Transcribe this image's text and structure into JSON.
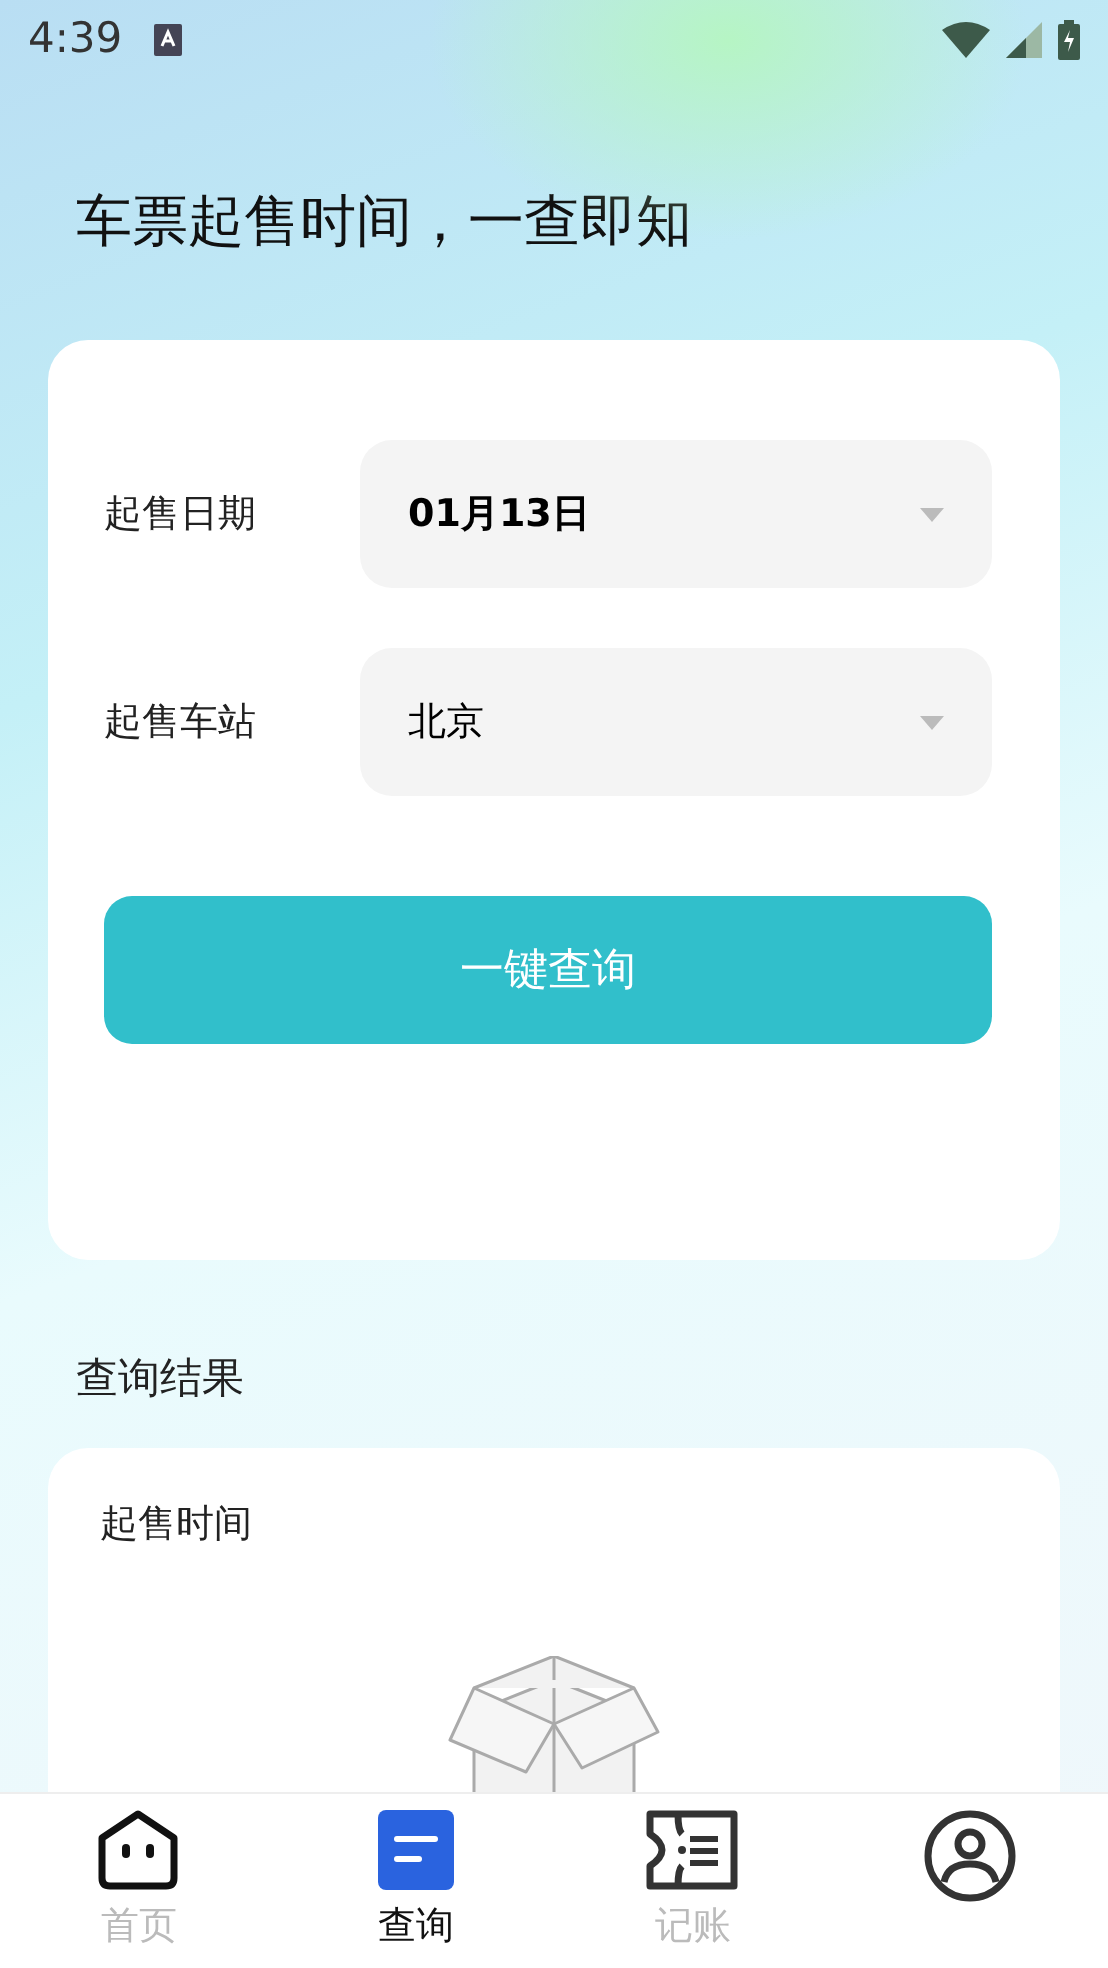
{
  "status_bar": {
    "time": "4:39"
  },
  "heading": "车票起售时间，一查即知",
  "form": {
    "fields": [
      {
        "label": "起售日期",
        "value": "01月13日",
        "bold": true
      },
      {
        "label": "起售车站",
        "value": "北京",
        "bold": false
      }
    ],
    "button": "一键查询"
  },
  "results": {
    "title": "查询结果",
    "card_title": "起售时间"
  },
  "tabs": [
    {
      "label": "首页",
      "kind": "home",
      "selected": false
    },
    {
      "label": "查询",
      "kind": "query",
      "selected": true
    },
    {
      "label": "记账",
      "kind": "ticket",
      "selected": false
    },
    {
      "kind": "user",
      "selected": false
    }
  ]
}
